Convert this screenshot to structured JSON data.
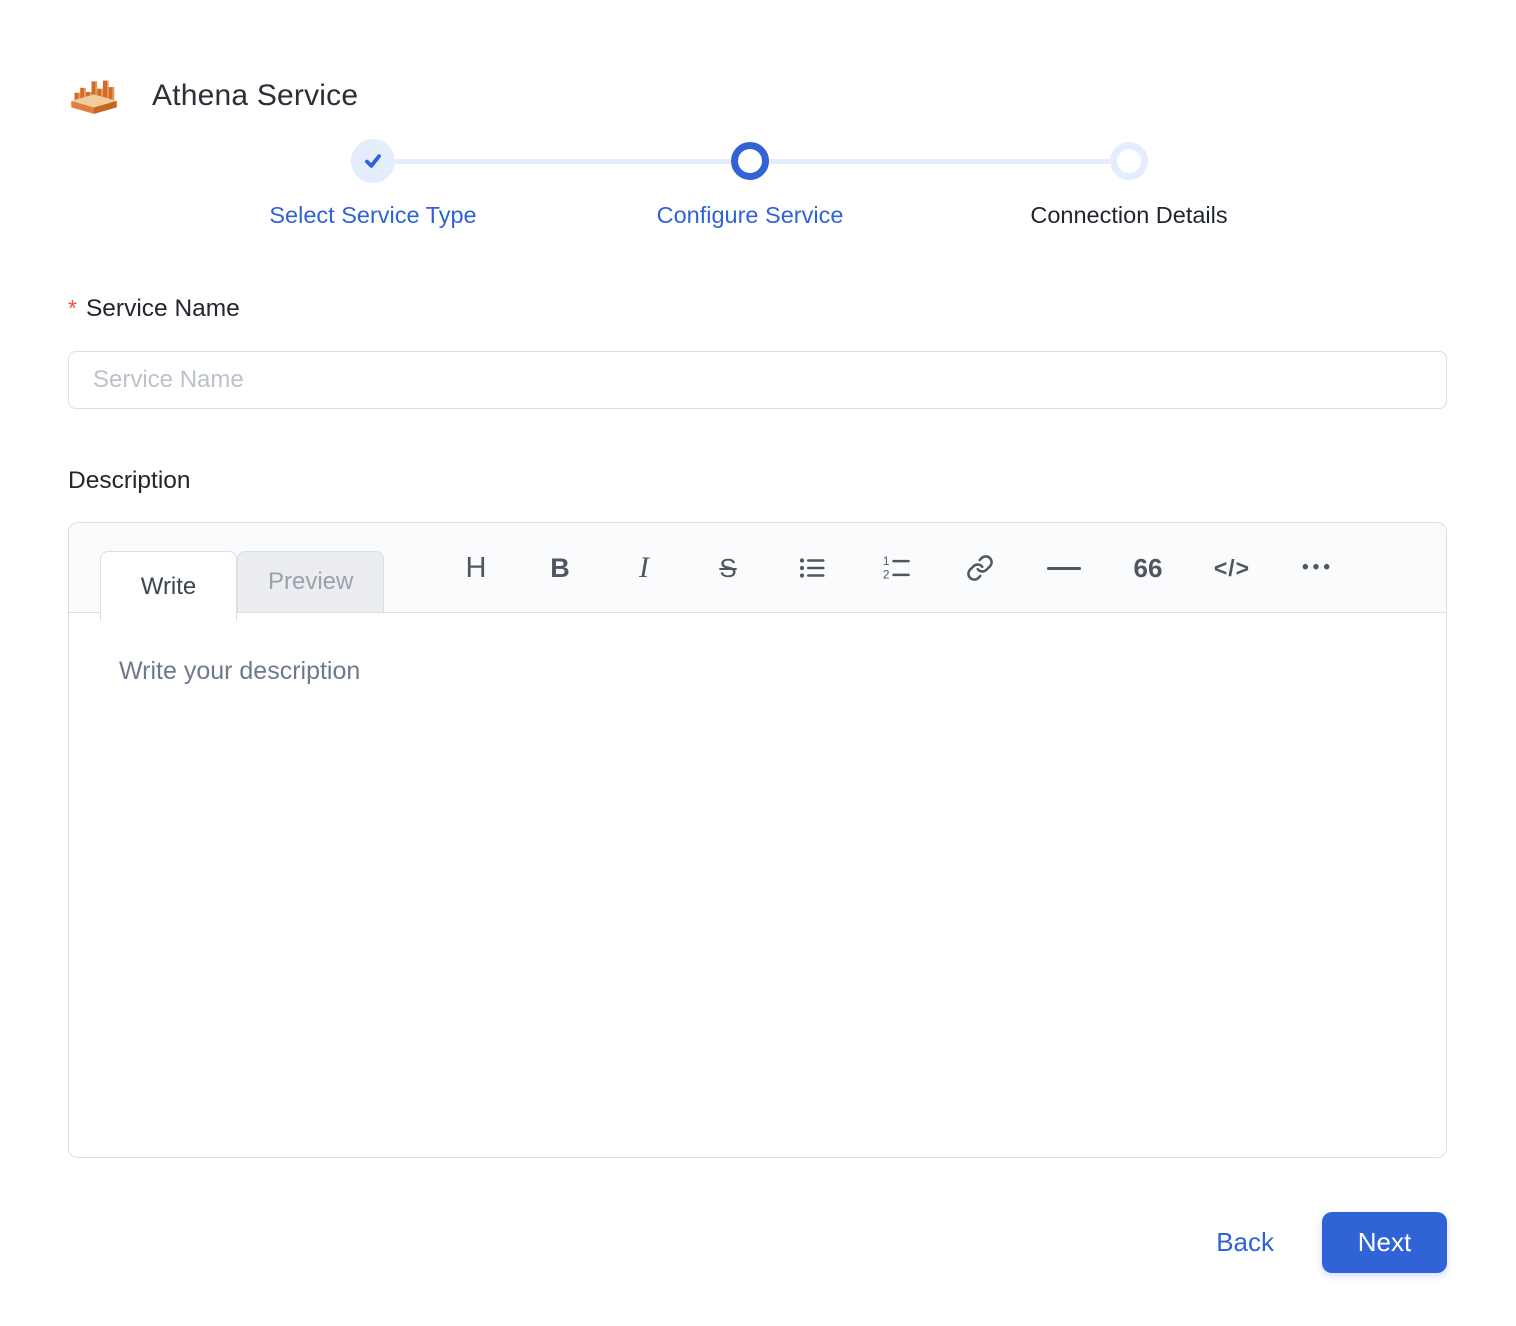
{
  "header": {
    "title": "Athena Service",
    "logo_name": "athena-service-logo"
  },
  "stepper": {
    "steps": [
      {
        "label": "Select Service Type",
        "state": "completed"
      },
      {
        "label": "Configure Service",
        "state": "active"
      },
      {
        "label": "Connection Details",
        "state": "upcoming"
      }
    ]
  },
  "form": {
    "service_name": {
      "label": "Service Name",
      "required_marker": "*",
      "placeholder": "Service Name",
      "value": ""
    },
    "description": {
      "label": "Description",
      "tabs": {
        "write": "Write",
        "preview": "Preview"
      },
      "active_tab": "Write",
      "placeholder": "Write your description",
      "value": "",
      "toolbar": {
        "heading": "H",
        "bold": "B",
        "italic": "I",
        "strikethrough": "S",
        "quote": "66",
        "code": "</>",
        "more": "•••"
      },
      "toolbar_icons": [
        "heading",
        "bold",
        "italic",
        "strikethrough",
        "bulleted-list",
        "numbered-list",
        "link",
        "horizontal-rule",
        "quote",
        "code",
        "more"
      ]
    }
  },
  "footer": {
    "back_label": "Back",
    "next_label": "Next"
  },
  "colors": {
    "primary_blue": "#2F63D6",
    "light_blue": "#E3EDFB",
    "upcoming_step_text": "#1F242D",
    "required_red": "#EB5349",
    "next_button_bg": "#2F63D6",
    "next_button_text": "#FFFFFF",
    "logo_orange_dark": "#CE6D28",
    "logo_orange_light": "#E89A55",
    "logo_tan": "#F2CC9C"
  }
}
